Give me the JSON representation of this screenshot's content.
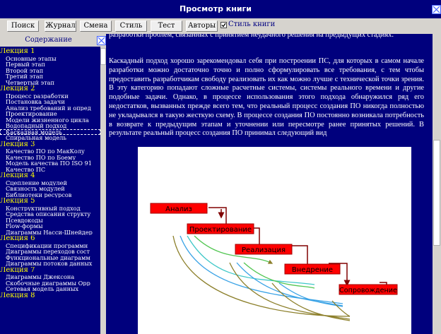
{
  "window": {
    "title": "Просмотр книги"
  },
  "toolbar": {
    "buttons": [
      "Поиск",
      "Журнал",
      "Смена",
      "Стиль",
      "Тест",
      "Авторы"
    ],
    "style_checkbox_label": "Стиль книги",
    "style_checkbox_checked": true
  },
  "sidebar": {
    "header": "Содержание",
    "items": [
      {
        "type": "lecture",
        "label": "Лекция 1"
      },
      {
        "type": "item",
        "label": "Основные этапы"
      },
      {
        "type": "item",
        "label": "Первый этап"
      },
      {
        "type": "item",
        "label": "Второй этап"
      },
      {
        "type": "item",
        "label": "Третий этап"
      },
      {
        "type": "item",
        "label": "Четвертый этап"
      },
      {
        "type": "lecture",
        "label": "Лекция 2"
      },
      {
        "type": "item",
        "label": "Процесс разработки"
      },
      {
        "type": "item",
        "label": "Постановка задачи"
      },
      {
        "type": "item",
        "label": "Анализ требований и опред"
      },
      {
        "type": "item",
        "label": "Проектирование"
      },
      {
        "type": "item",
        "label": "Модели жизненного цикла"
      },
      {
        "type": "item",
        "label": "Водопадный подход"
      },
      {
        "type": "item",
        "label": "Каскадная модель",
        "selected": true
      },
      {
        "type": "item",
        "label": "Спиральная модель"
      },
      {
        "type": "lecture",
        "label": "Лекция 3"
      },
      {
        "type": "item",
        "label": "Качество ПО по МакКолу"
      },
      {
        "type": "item",
        "label": "Качество ПО по Боему"
      },
      {
        "type": "item",
        "label": "Модель качества ПО ISO 91"
      },
      {
        "type": "item",
        "label": "Качество ПС"
      },
      {
        "type": "lecture",
        "label": "Лекция 4"
      },
      {
        "type": "item",
        "label": "Сцепление модулей"
      },
      {
        "type": "item",
        "label": "Связность модулей"
      },
      {
        "type": "item",
        "label": "Библиотеки ресурсов"
      },
      {
        "type": "lecture",
        "label": "Лекция 5"
      },
      {
        "type": "item",
        "label": "Конструктивный подход"
      },
      {
        "type": "item",
        "label": "Средства описания структу"
      },
      {
        "type": "item",
        "label": "Псевдокоды"
      },
      {
        "type": "item",
        "label": "Flow-формы"
      },
      {
        "type": "item",
        "label": "Диаграммы Насси-Шнейдер"
      },
      {
        "type": "lecture",
        "label": "Лекция 6"
      },
      {
        "type": "item",
        "label": "Спецификации программн"
      },
      {
        "type": "item",
        "label": "Диаграммы переходов сост"
      },
      {
        "type": "item",
        "label": "Функциональные диаграмм"
      },
      {
        "type": "item",
        "label": "Диаграммы потоков данных"
      },
      {
        "type": "lecture",
        "label": "Лекция 7"
      },
      {
        "type": "item",
        "label": "Диаграммы Джексона"
      },
      {
        "type": "item",
        "label": "Скобочные диаграммы Орр"
      },
      {
        "type": "item",
        "label": "Сетевая модель данных"
      },
      {
        "type": "lecture",
        "label": "Лекция 8"
      }
    ]
  },
  "content": {
    "intro_fragment": "разработки проблем, связанных с принятием неудачного решения на предыдущих стадиях.",
    "paragraph": " Каскадный подход хорошо зарекомендовал себя при построении ПС, для которых в самом начале разработки можно достаточно точно и полно сформулировать все требования, с тем чтобы предоставить разработчикам свободу реализовать их как можно лучше с технической точки зрения. В эту категорию попадают сложные расчетные системы, системы реального времени и другие подобные задачи. Однако, в процессе использования этого подхода обнаружился ряд его недостатков, вызванных прежде всего тем, что реальный процесс создания ПО никогда полностью не укладывался в такую жесткую схему. В процессе создания ПО постоянно возникала потребность в возврате к предыдущим этапам и уточнении или пересмотре ранее принятых решений. В результате реальный процесс создания ПО принимал следующий вид",
    "diagram": {
      "stages": [
        "Анализ",
        "Проектирование",
        "Реализация",
        "Внедрение",
        "Сопровождение"
      ],
      "colors": {
        "box": "#ff0000",
        "arrow": "#800000"
      }
    }
  }
}
